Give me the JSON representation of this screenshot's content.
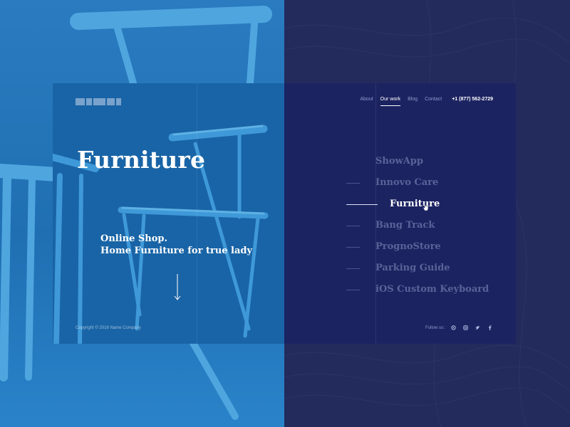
{
  "brand": {
    "logo_text": ""
  },
  "nav": {
    "items": [
      {
        "label": "About",
        "active": false
      },
      {
        "label": "Our work",
        "active": true
      },
      {
        "label": "Blog",
        "active": false
      },
      {
        "label": "Contact",
        "active": false
      }
    ],
    "phone": "+1 (877) 562-2729"
  },
  "hero": {
    "title": "Furniture",
    "subtitle_line1": "Online Shop.",
    "subtitle_line2": "Home Furniture for true lady",
    "scroll_icon": "arrow-down-icon"
  },
  "works": {
    "items": [
      {
        "label": "ShowApp",
        "active": false
      },
      {
        "label": "Innovo Care",
        "active": false
      },
      {
        "label": "Furniture",
        "active": true
      },
      {
        "label": "Bang Track",
        "active": false
      },
      {
        "label": "PrognoStore",
        "active": false
      },
      {
        "label": "Parking Guide",
        "active": false
      },
      {
        "label": "iOS Custom Keyboard",
        "active": false
      }
    ]
  },
  "footer": {
    "copyright": "Copyright © 2016 Name Company",
    "follow_label": "Follow us:",
    "social_icons": [
      "dribbble-icon",
      "instagram-icon",
      "twitter-icon",
      "facebook-icon"
    ]
  },
  "colors": {
    "accent_blue": "#1964a6",
    "navy": "#1c2361",
    "text_white": "#ffffff",
    "muted": "#5a6398"
  }
}
